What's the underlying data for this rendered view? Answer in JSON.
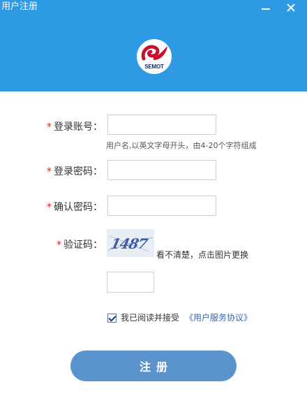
{
  "window": {
    "title": "用户注册",
    "minimize_label": "—",
    "close_label": "✕"
  },
  "logo": {
    "text": "SEMOT"
  },
  "form": {
    "account": {
      "required_mark": "*",
      "label": "登录账号：",
      "value": "",
      "hint": "用户名,以英文字母开头，由4-20个字符组成"
    },
    "password": {
      "required_mark": "*",
      "label": "登录密码：",
      "value": ""
    },
    "confirm": {
      "required_mark": "*",
      "label": "确认密码：",
      "value": ""
    },
    "captcha": {
      "required_mark": "*",
      "label": "验证码：",
      "image_text": "1487",
      "hint": "看不清楚，点击图片更换",
      "value": ""
    },
    "agreement": {
      "checked": true,
      "text": "我已阅读并接受",
      "link": "《用户服务协议》"
    },
    "submit_label": "注册"
  },
  "colors": {
    "header": "#2e9ae3",
    "button": "#5b94cc",
    "required": "#dd2222",
    "link": "#3366bb"
  }
}
